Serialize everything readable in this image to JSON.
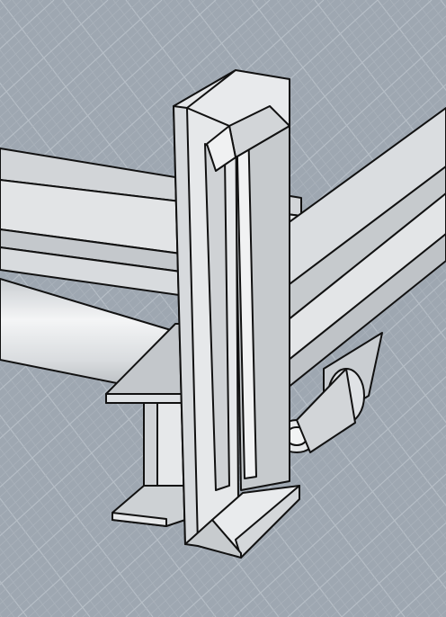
{
  "viewport": {
    "background_color": "#9ea7b1",
    "grid_minor_color": "#aab2bb",
    "grid_major_color": "#b6bec6",
    "outline_color": "#111111"
  },
  "materials": {
    "steel_light": "#e4e6e8",
    "steel_mid": "#cfd2d5",
    "steel_dark": "#b8bcc0",
    "steel_shadow": "#a4a9ae"
  },
  "scene": {
    "objects": [
      {
        "name": "vertical-channel-post"
      },
      {
        "name": "i-beam-profile"
      },
      {
        "name": "diagonal-angle-beam"
      },
      {
        "name": "rear-pipe"
      },
      {
        "name": "rear-flat-beam"
      },
      {
        "name": "roller-bracket"
      }
    ]
  }
}
